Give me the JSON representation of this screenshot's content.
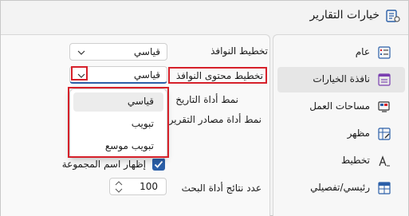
{
  "window": {
    "title": "خيارات التقارير"
  },
  "nav": {
    "items": [
      {
        "label": "عام"
      },
      {
        "label": "نافذة الخيارات"
      },
      {
        "label": "مساحات العمل"
      },
      {
        "label": "مظهر"
      },
      {
        "label": "تخطيط"
      },
      {
        "label": "رئيسي/تفصيلي"
      }
    ],
    "selected_index": 1
  },
  "content": {
    "window_layout_label": "تخطيط النوافذ",
    "window_layout_value": "قياسي",
    "content_layout_label": "تخطيط محتوى النوافذ",
    "content_layout_value": "قياسي",
    "date_tool_style_label": "نمط أداة التاريخ",
    "sources_tool_style_label": "نمط أداة مصادر التقرير",
    "show_group_name_label": "إظهار اسم المجموعة",
    "show_group_name_checked": true,
    "search_results_label": "عدد نتائج أداة البحث",
    "search_results_value": "100"
  },
  "dropdown": {
    "options": [
      "قياسي",
      "تبويب",
      "تبويب موسع"
    ],
    "selected": "قياسي"
  },
  "colors": {
    "accent": "#2b5fa8",
    "highlight": "#d6202a"
  }
}
